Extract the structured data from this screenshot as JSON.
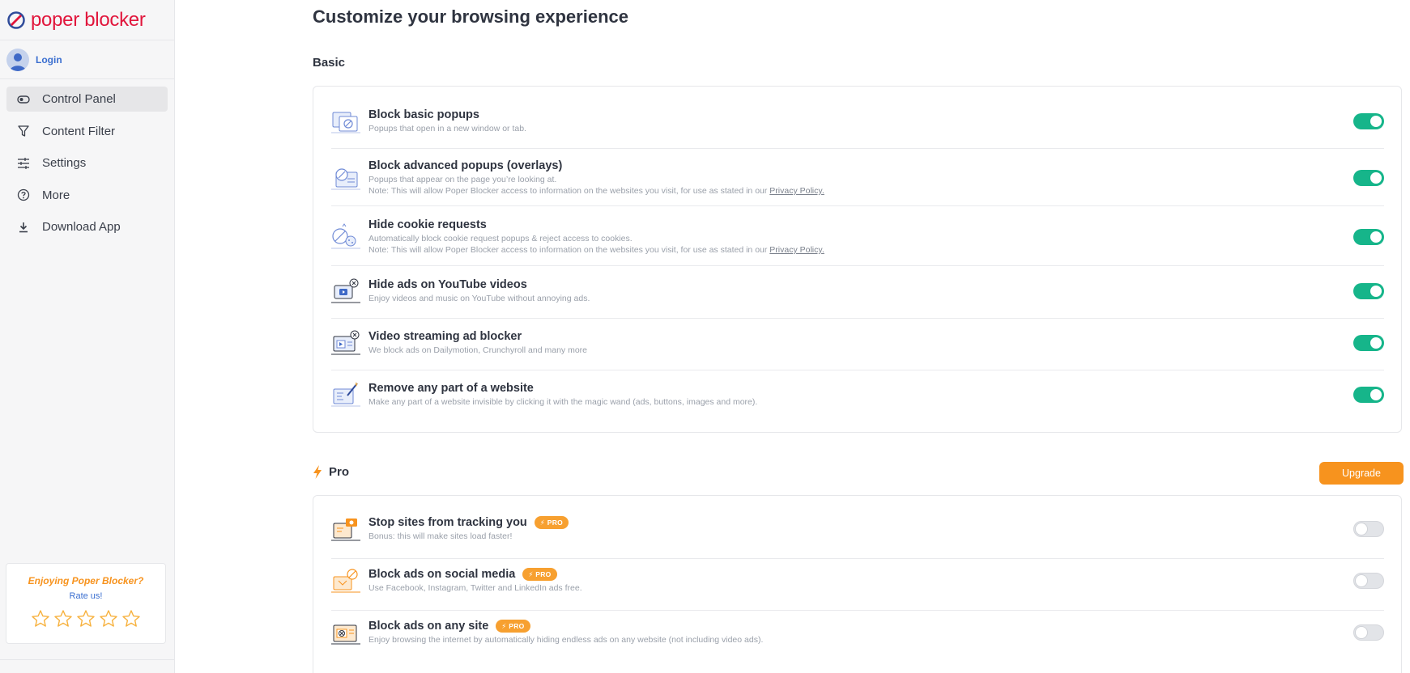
{
  "brand": {
    "name": "poper blocker",
    "color": "#e1163c"
  },
  "user": {
    "login_label": "Login"
  },
  "nav": {
    "items": [
      {
        "label": "Control Panel",
        "icon": "toggle-icon",
        "active": true
      },
      {
        "label": "Content Filter",
        "icon": "funnel-icon",
        "active": false
      },
      {
        "label": "Settings",
        "icon": "sliders-icon",
        "active": false
      },
      {
        "label": "More",
        "icon": "question-icon",
        "active": false
      },
      {
        "label": "Download App",
        "icon": "download-icon",
        "active": false
      }
    ]
  },
  "rate": {
    "title": "Enjoying Poper Blocker?",
    "subtitle": "Rate us!",
    "stars": 5
  },
  "main": {
    "title": "Customize your browsing experience",
    "basic": {
      "heading": "Basic",
      "features": [
        {
          "title": "Block basic popups",
          "desc": "Popups that open in a new window or tab.",
          "enabled": true
        },
        {
          "title": "Block advanced popups (overlays)",
          "desc": "Popups that appear on the page you’re looking at.",
          "note": "Note: This will allow Poper Blocker access to information on the websites you visit, for use as stated in our ",
          "link": "Privacy Policy.",
          "enabled": true
        },
        {
          "title": "Hide cookie requests",
          "desc": "Automatically block cookie request popups & reject access to cookies.",
          "note": "Note: This will allow Poper Blocker access to information on the websites you visit, for use as stated in our ",
          "link": "Privacy Policy.",
          "enabled": true
        },
        {
          "title": "Hide ads on YouTube videos",
          "desc": "Enjoy videos and music on YouTube without annoying ads.",
          "enabled": true
        },
        {
          "title": "Video streaming ad blocker",
          "desc": "We block ads on Dailymotion, Crunchyroll and many more",
          "enabled": true
        },
        {
          "title": "Remove any part of a website",
          "desc": "Make any part of a website invisible by clicking it with the magic wand (ads, buttons, images and more).",
          "enabled": true
        }
      ]
    },
    "pro": {
      "heading": "Pro",
      "upgrade_label": "Upgrade",
      "badge": "PRO",
      "features": [
        {
          "title": "Stop sites from tracking you",
          "desc": "Bonus: this will make sites load faster!",
          "enabled": false
        },
        {
          "title": "Block ads on social media",
          "desc": "Use Facebook, Instagram, Twitter and LinkedIn ads free.",
          "enabled": false
        },
        {
          "title": "Block ads on any site",
          "desc": "Enjoy browsing the internet by automatically hiding endless ads on any website (not including video ads).",
          "enabled": false
        }
      ]
    }
  },
  "colors": {
    "toggle_on": "#16b58a",
    "accent_orange": "#f7931e",
    "link_blue": "#3b6fd0"
  }
}
